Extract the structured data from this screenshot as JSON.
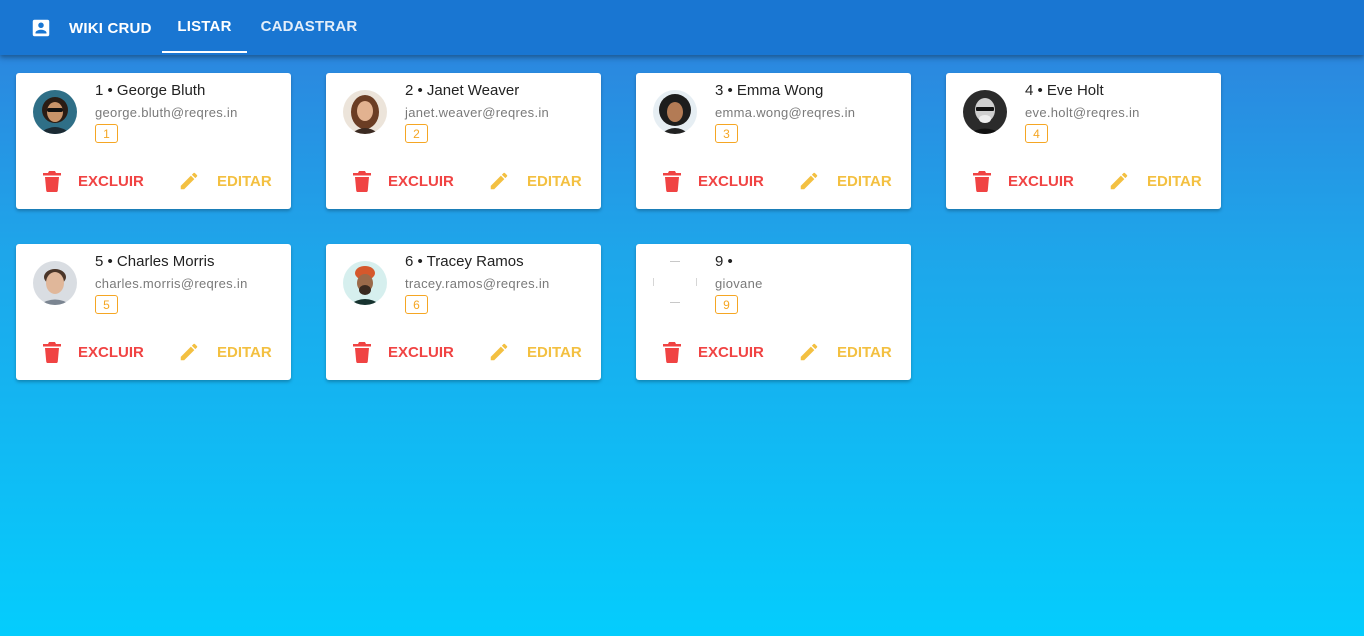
{
  "app": {
    "title": "WIKI CRUD",
    "icon": "account-box-icon"
  },
  "tabs": [
    {
      "label": "LISTAR",
      "active": true
    },
    {
      "label": "CADASTRAR",
      "active": false
    }
  ],
  "actions": {
    "delete_label": "EXCLUIR",
    "edit_label": "EDITAR",
    "delete_icon": "trash-icon",
    "edit_icon": "pencil-icon"
  },
  "colors": {
    "appbar": "#1976d2",
    "delete": "#f04343",
    "edit": "#f3c041",
    "badge": "#f5a623"
  },
  "users": [
    {
      "title": "1 • George Bluth",
      "email": "george.bluth@reqres.in",
      "id": "1"
    },
    {
      "title": "2 • Janet Weaver",
      "email": "janet.weaver@reqres.in",
      "id": "2"
    },
    {
      "title": "3 • Emma Wong",
      "email": "emma.wong@reqres.in",
      "id": "3"
    },
    {
      "title": "4 • Eve Holt",
      "email": "eve.holt@reqres.in",
      "id": "4"
    },
    {
      "title": "5 • Charles Morris",
      "email": "charles.morris@reqres.in",
      "id": "5"
    },
    {
      "title": "6 • Tracey Ramos",
      "email": "tracey.ramos@reqres.in",
      "id": "6"
    },
    {
      "title": "9 •",
      "email": "giovane",
      "id": "9"
    }
  ]
}
